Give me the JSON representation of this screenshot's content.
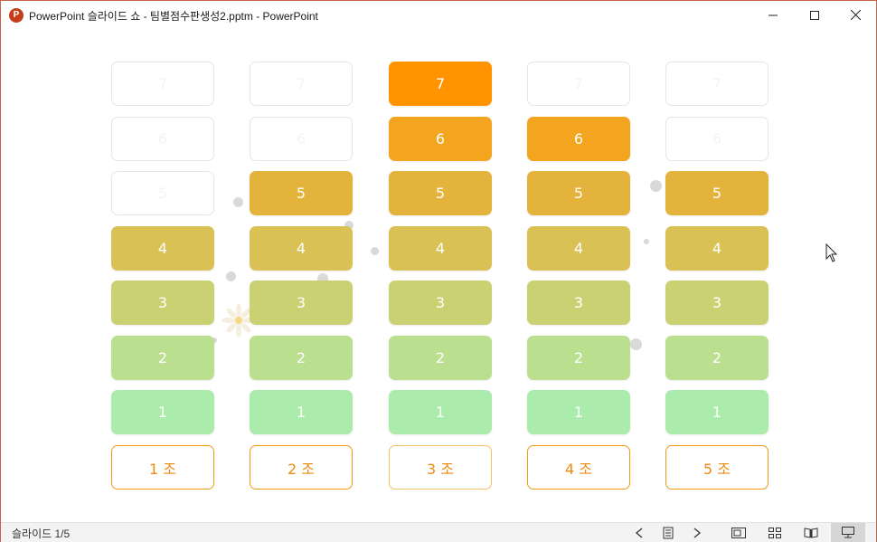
{
  "window": {
    "title": "PowerPoint 슬라이드 쇼  -  팀별점수판생성2.pptm - PowerPoint",
    "app_icon_letter": "P"
  },
  "board": {
    "levels": [
      "7",
      "6",
      "5",
      "4",
      "3",
      "2",
      "1"
    ],
    "level_colors": {
      "7": "#ff9300",
      "6": "#f3a51f",
      "5": "#e4b33b",
      "4": "#d9c156",
      "3": "#cad173",
      "2": "#b9df8f",
      "1": "#abecac"
    },
    "teams": [
      {
        "label": "1 조",
        "score": 4
      },
      {
        "label": "2 조",
        "score": 5
      },
      {
        "label": "3 조",
        "score": 7
      },
      {
        "label": "4 조",
        "score": 6
      },
      {
        "label": "5 조",
        "score": 5
      }
    ]
  },
  "statusbar": {
    "slide_indicator": "슬라이드 1/5"
  }
}
